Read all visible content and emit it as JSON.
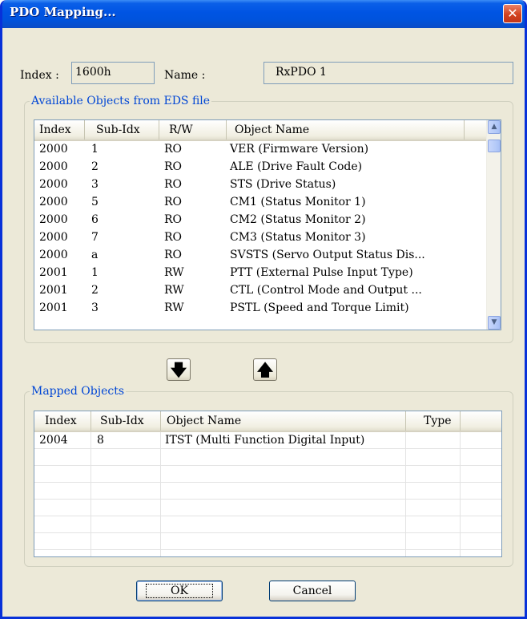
{
  "dialog": {
    "title": "PDO Mapping...",
    "close_glyph": "✕"
  },
  "header": {
    "index_label": "Index :",
    "index_value": "1600h",
    "name_label": "Name :",
    "name_value": "RxPDO 1"
  },
  "available": {
    "group_label": "Available Objects from EDS file",
    "columns": [
      "Index",
      "Sub-Idx",
      "R/W",
      "Object Name"
    ],
    "rows": [
      [
        "2000",
        "1",
        "RO",
        "VER (Firmware Version)"
      ],
      [
        "2000",
        "2",
        "RO",
        "ALE (Drive Fault Code)"
      ],
      [
        "2000",
        "3",
        "RO",
        "STS (Drive Status)"
      ],
      [
        "2000",
        "5",
        "RO",
        "CM1 (Status Monitor 1)"
      ],
      [
        "2000",
        "6",
        "RO",
        "CM2 (Status Monitor 2)"
      ],
      [
        "2000",
        "7",
        "RO",
        "CM3 (Status Monitor 3)"
      ],
      [
        "2000",
        "a",
        "RO",
        "SVSTS (Servo Output Status Dis..."
      ],
      [
        "2001",
        "1",
        "RW",
        "PTT (External Pulse Input Type)"
      ],
      [
        "2001",
        "2",
        "RW",
        "CTL (Control Mode and Output ..."
      ],
      [
        "2001",
        "3",
        "RW",
        "PSTL (Speed and Torque Limit)"
      ]
    ]
  },
  "move_buttons": {
    "down_glyph": "🡇",
    "up_glyph": "🡅"
  },
  "mapped": {
    "group_label": "Mapped Objects",
    "columns": [
      "Index",
      "Sub-Idx",
      "Object Name",
      "Type"
    ],
    "rows": [
      [
        "2004",
        "8",
        "ITST (Multi Function Digital Input)",
        ""
      ]
    ]
  },
  "buttons": {
    "ok_label": "OK",
    "cancel_label": "Cancel"
  },
  "icons": {
    "close": "close-icon",
    "scroll_up": "chevron-up-icon",
    "scroll_down": "chevron-down-icon",
    "move_down": "arrow-down-icon",
    "move_up": "arrow-up-icon"
  }
}
